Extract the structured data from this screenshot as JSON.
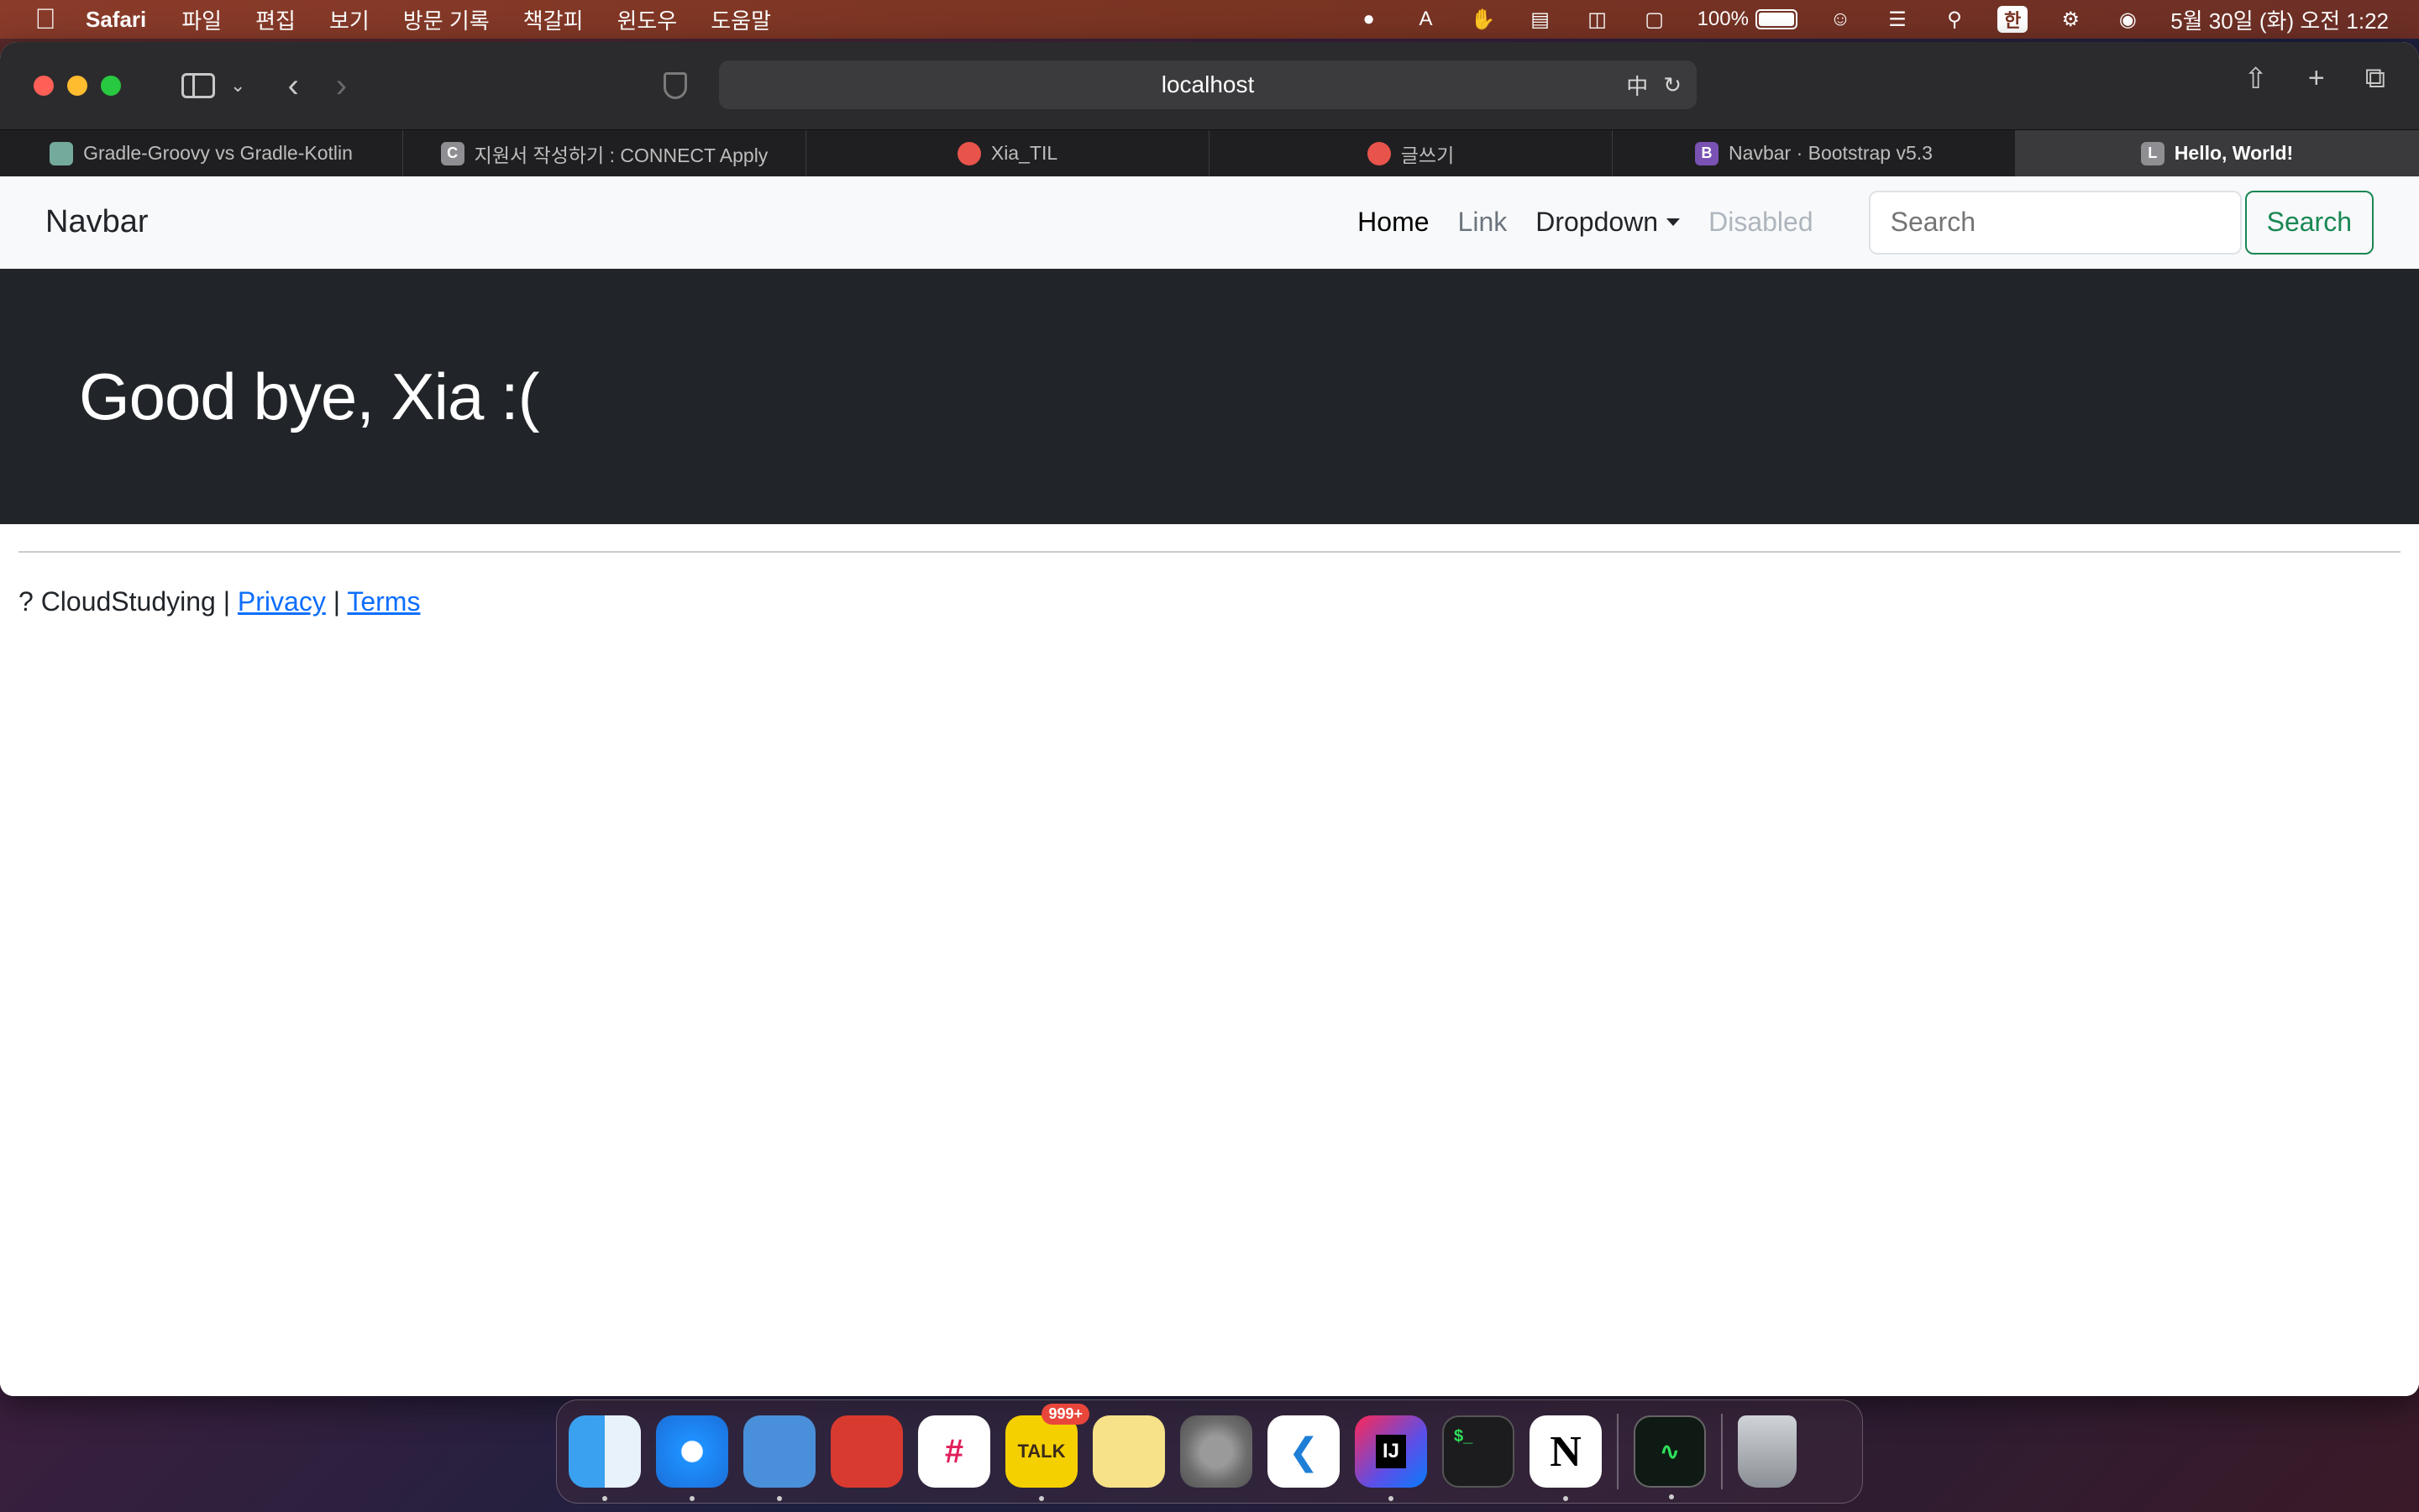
{
  "menubar": {
    "app_name": "Safari",
    "menus": [
      "파일",
      "편집",
      "보기",
      "방문 기록",
      "책갈피",
      "윈도우",
      "도움말"
    ],
    "battery": "100%",
    "input_method": "한",
    "datetime": "5월 30일 (화) 오전 1:22"
  },
  "browser": {
    "url": "localhost",
    "tabs": [
      {
        "label": "Gradle-Groovy vs Gradle-Kotlin",
        "favicon_color": "#74aa9c",
        "favicon_char": ""
      },
      {
        "label": "지원서 작성하기 : CONNECT Apply",
        "favicon_color": "#8e8e93",
        "favicon_char": "C"
      },
      {
        "label": "Xia_TIL",
        "favicon_color": "#e8544b",
        "favicon_char": ""
      },
      {
        "label": "글쓰기",
        "favicon_color": "#e8544b",
        "favicon_char": ""
      },
      {
        "label": "Navbar · Bootstrap v5.3",
        "favicon_color": "#7952b3",
        "favicon_char": "B"
      },
      {
        "label": "Hello, World!",
        "favicon_color": "#8e8e93",
        "favicon_char": "L"
      }
    ]
  },
  "page": {
    "navbar": {
      "brand": "Navbar",
      "links": {
        "home": "Home",
        "link": "Link",
        "dropdown": "Dropdown",
        "disabled": "Disabled"
      },
      "search_placeholder": "Search",
      "search_button": "Search"
    },
    "hero": {
      "title": "Good bye, Xia :("
    },
    "footer": {
      "prefix": "? CloudStudying | ",
      "privacy": "Privacy",
      "separator": " | ",
      "terms": "Terms"
    }
  },
  "dock": {
    "talk_badge": "999+",
    "talk_label": "TALK"
  }
}
